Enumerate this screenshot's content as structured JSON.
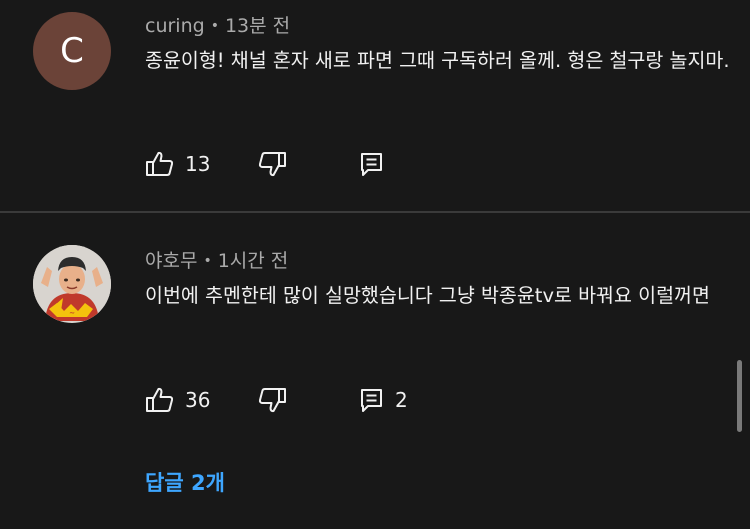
{
  "comments": [
    {
      "avatar_letter": "C",
      "avatar_color": "#6b4338",
      "author": "curing",
      "time": "13분 전",
      "text": "종윤이형! 채널 혼자 새로 파면 그때 구독하러 올께.  형은 철구랑 놀지마.",
      "likes": "13",
      "replies_count": ""
    },
    {
      "avatar_icon": "cartoon-man-avatar",
      "author": "야호무",
      "time": "1시간 전",
      "text": "이번에 추멘한테 많이 실망했습니다 그냥 박종윤tv로 바꿔요 이럴꺼면",
      "likes": "36",
      "replies_count": "2",
      "replies_link": "답글 2개"
    }
  ],
  "colors": {
    "background": "#181818",
    "link": "#3ea6ff",
    "meta": "#aaaaaa"
  },
  "icons": [
    "thumb-up-icon",
    "thumb-down-icon",
    "reply-icon"
  ]
}
